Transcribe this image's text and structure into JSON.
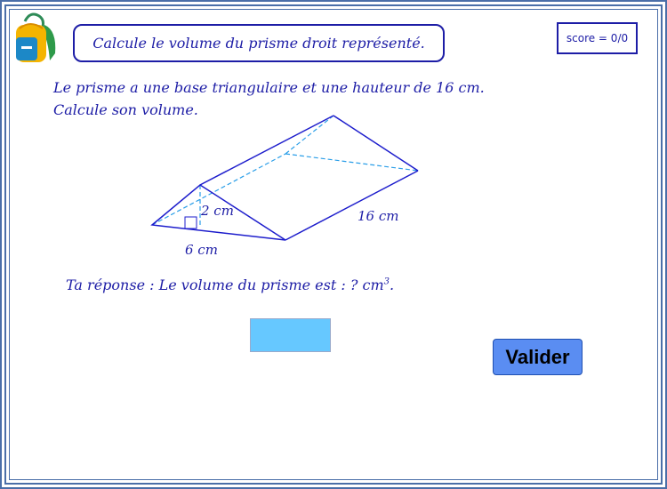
{
  "header": {
    "title": "Calcule le volume du prisme droit représenté.",
    "score": "score = 0/0"
  },
  "exercise": {
    "intro_line1": "Le prisme a une base triangulaire et une hauteur de 16 cm.",
    "intro_line2": "Calcule son volume.",
    "figure_labels": {
      "height": "2 cm",
      "base": "6 cm",
      "length": "16 cm"
    },
    "answer_prefix": "Ta réponse :  Le volume du prisme est : ? cm",
    "answer_exponent": "3",
    "answer_suffix": "."
  },
  "answer_input": {
    "value": "",
    "placeholder": ""
  },
  "buttons": {
    "validate": "Valider"
  },
  "icons": {
    "logo": "backpack-icon"
  },
  "colors": {
    "frame": "#4a6ea8",
    "text": "#1d1da6",
    "input_bg": "#66c8ff",
    "button_bg": "#5a8df2",
    "figure": "#1d1dcc",
    "hidden_edges": "#2a9ee8"
  }
}
